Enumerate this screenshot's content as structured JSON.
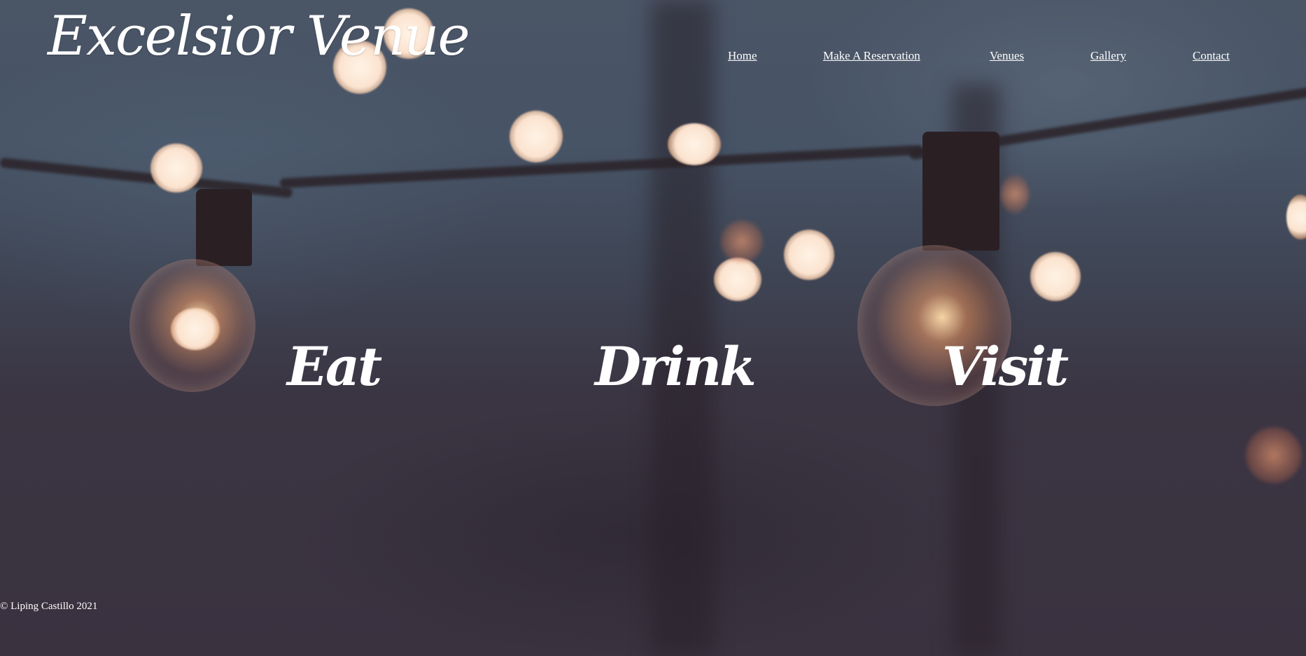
{
  "header": {
    "logo_text": "Excelsior Venue"
  },
  "nav": {
    "items": [
      {
        "label": "Home"
      },
      {
        "label": "Make A Reservation"
      },
      {
        "label": "Venues"
      },
      {
        "label": "Gallery"
      },
      {
        "label": "Contact"
      }
    ]
  },
  "hero": {
    "words": [
      "Eat",
      "Drink",
      "Visit"
    ]
  },
  "footer": {
    "copyright": "© Liping Castillo 2021"
  },
  "colors": {
    "text": "#ffffff",
    "background_dark": "#3a323f",
    "background_sky": "#4a5566",
    "light_glow": "#fbe3cf"
  }
}
